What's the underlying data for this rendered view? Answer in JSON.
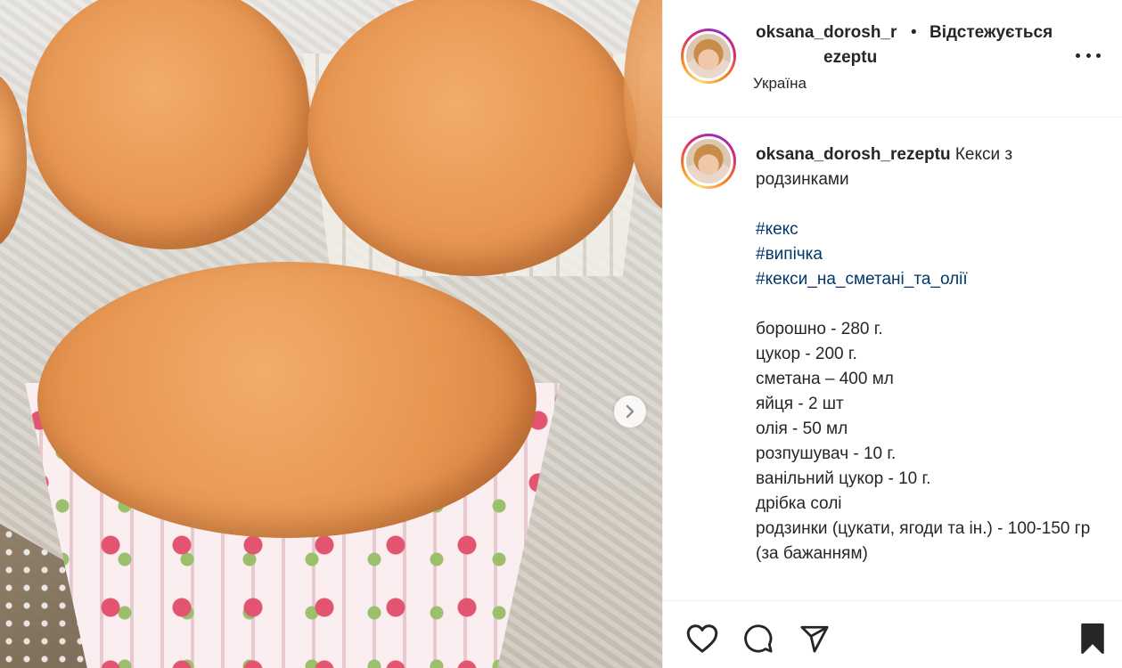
{
  "post": {
    "author": {
      "username_line1": "oksana_dorosh_r",
      "username_line2": "ezeptu",
      "follow_status": "Відстежується",
      "separator": "•",
      "location": "Україна"
    },
    "caption": {
      "username": "oksana_dorosh_rezeptu",
      "title": "Кекси з родзинками",
      "hashtags": [
        "#кекс",
        "#випічка",
        "#кекси_на_сметані_та_олії"
      ],
      "ingredients": [
        "борошно - 280 г.",
        "цукор - 200 г.",
        "сметана – 400 мл",
        "яйця - 2 шт",
        "олія - 50 мл",
        "розпушувач - 10 г.",
        "ванільний цукор - 10 г.",
        "дрібка солі",
        "родзинки (цукати, ягоди та ін.) - 100-150 гр (за бажанням)"
      ]
    },
    "icons": {
      "more": "more-horizontal-icon",
      "next": "chevron-right-icon",
      "like": "heart-icon",
      "comment": "comment-icon",
      "share": "send-icon",
      "save": "bookmark-icon"
    }
  }
}
